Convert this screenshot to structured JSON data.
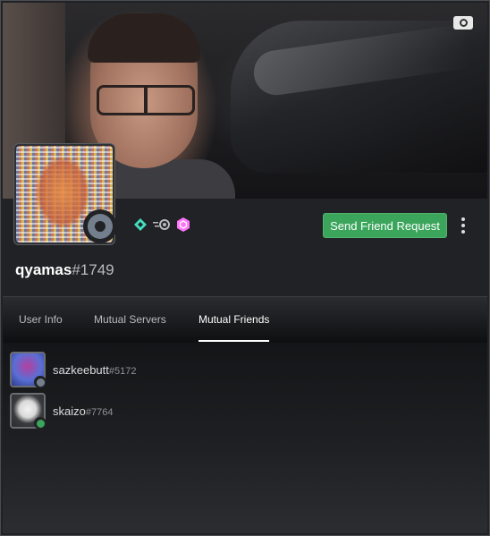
{
  "profile": {
    "username": "qyamas",
    "discriminator": "#1749",
    "badges": [
      "hypesquad-balance-icon",
      "nitro-icon",
      "server-boost-icon"
    ],
    "status_icon": "offline-status-icon",
    "banner_icon": "gif-icon"
  },
  "actions": {
    "send_friend_request": "Send Friend Request",
    "more_icon": "more-vertical-icon"
  },
  "tabs": [
    {
      "label": "User Info",
      "active": false
    },
    {
      "label": "Mutual Servers",
      "active": false
    },
    {
      "label": "Mutual Friends",
      "active": true
    }
  ],
  "mutual_friends": [
    {
      "name": "sazkeebutt",
      "discriminator": "#5172",
      "status": "offline"
    },
    {
      "name": "skaizo",
      "discriminator": "#7764",
      "status": "online"
    }
  ],
  "colors": {
    "accent_green": "#3ba55c",
    "online": "#3ba55c",
    "offline": "#747f8d",
    "background": "#202225"
  }
}
